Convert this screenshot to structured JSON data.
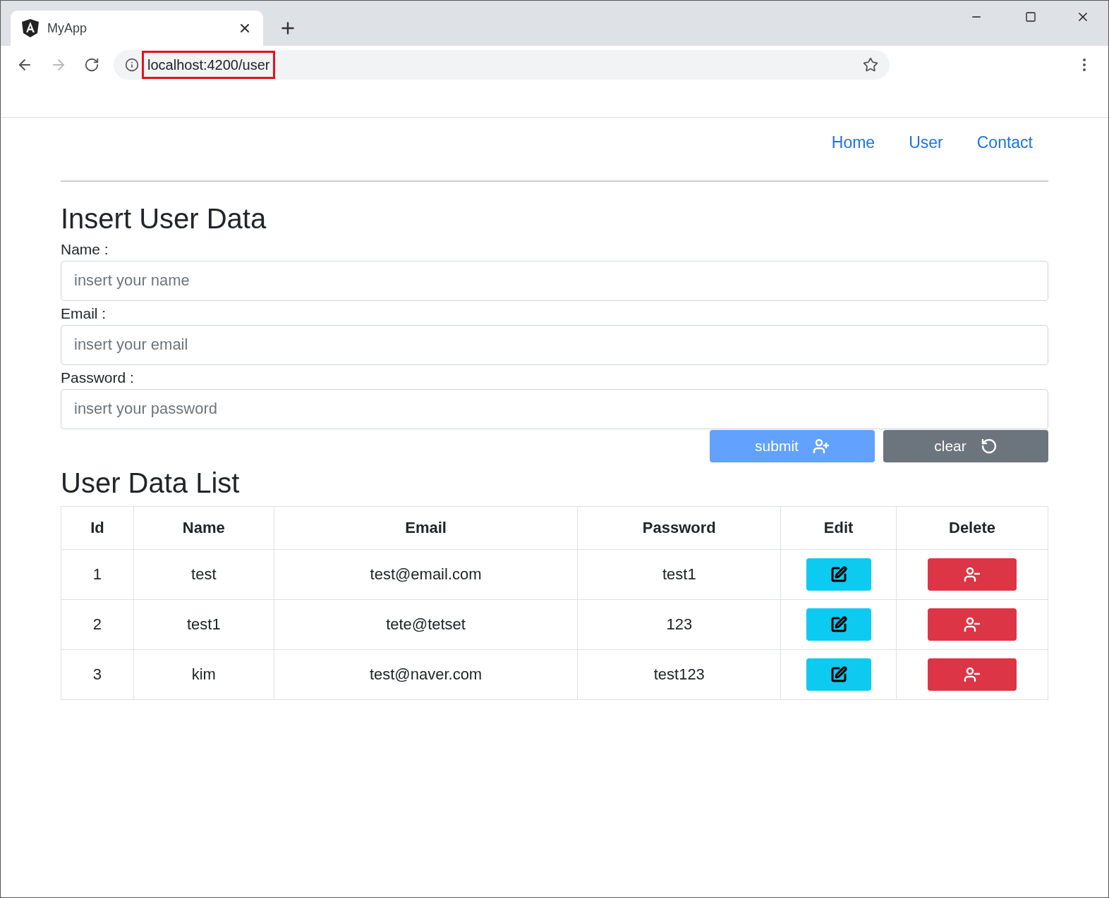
{
  "browser": {
    "tab_title": "MyApp",
    "url": "localhost:4200/user",
    "url_highlighted": true
  },
  "nav": [
    "Home",
    "User",
    "Contact"
  ],
  "form": {
    "title": "Insert User Data",
    "fields": [
      {
        "label": "Name :",
        "placeholder": "insert your name"
      },
      {
        "label": "Email :",
        "placeholder": "insert your email"
      },
      {
        "label": "Password :",
        "placeholder": "insert your password"
      }
    ],
    "buttons": [
      {
        "kind": "submit",
        "label": "submit",
        "disabled": true
      },
      {
        "kind": "clear",
        "label": "clear",
        "disabled": false
      }
    ]
  },
  "list": {
    "title": "User Data List",
    "columns": [
      "Id",
      "Name",
      "Email",
      "Password",
      "Edit",
      "Delete"
    ],
    "rows": [
      {
        "cells": [
          "1",
          "test",
          "test@email.com",
          "test1"
        ]
      },
      {
        "cells": [
          "2",
          "test1",
          "tete@tetset",
          "123"
        ]
      },
      {
        "cells": [
          "3",
          "kim",
          "test@naver.com",
          "test123"
        ]
      }
    ]
  }
}
